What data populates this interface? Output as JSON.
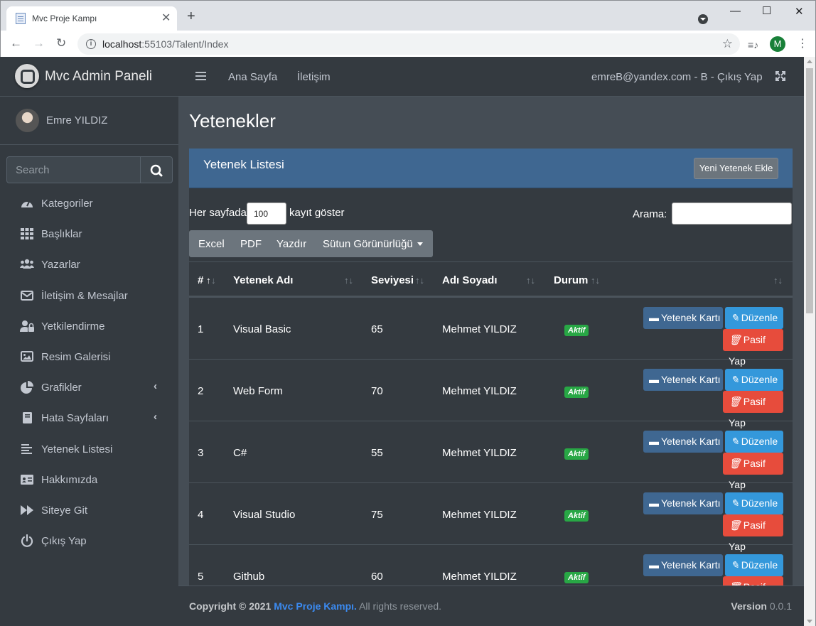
{
  "browser": {
    "tab_title": "Mvc Proje Kampı",
    "url_host": "localhost",
    "url_rest": ":55103/Talent/Index",
    "profile_initial": "M"
  },
  "sidebar": {
    "brand": "Mvc Admin Paneli",
    "user": "Emre YILDIZ",
    "search_placeholder": "Search",
    "items": [
      {
        "label": "Kategoriler",
        "icon": "tachometer-icon"
      },
      {
        "label": "Başlıklar",
        "icon": "grid-icon"
      },
      {
        "label": "Yazarlar",
        "icon": "users-icon"
      },
      {
        "label": "İletişim & Mesajlar",
        "icon": "envelope-icon"
      },
      {
        "label": "Yetkilendirme",
        "icon": "user-lock-icon"
      },
      {
        "label": "Resim Galerisi",
        "icon": "image-icon"
      },
      {
        "label": "Grafikler",
        "icon": "pie-chart-icon",
        "chevron": true
      },
      {
        "label": "Hata Sayfaları",
        "icon": "book-icon",
        "chevron": true
      },
      {
        "label": "Yetenek Listesi",
        "icon": "align-left-icon"
      },
      {
        "label": "Hakkımızda",
        "icon": "id-card-icon"
      },
      {
        "label": "Siteye Git",
        "icon": "forward-icon"
      },
      {
        "label": "Çıkış Yap",
        "icon": "power-icon"
      }
    ]
  },
  "topbar": {
    "home": "Ana Sayfa",
    "contact": "İletişim",
    "account": "emreB@yandex.com - B - Çıkış Yap"
  },
  "page": {
    "title": "Yetenekler",
    "card_title": "Yetenek Listesi",
    "new_button": "Yeni Yetenek Ekle",
    "per_page_label": "Her sayfada",
    "per_page_value": "100",
    "per_page_suffix": "kayıt göster",
    "search_label": "Arama:",
    "export_buttons": [
      "Excel",
      "PDF",
      "Yazdır",
      "Sütun Görünürlüğü"
    ],
    "columns": [
      "#",
      "Yetenek Adı",
      "Seviyesi",
      "Adı Soyadı",
      "Durum"
    ],
    "btn_card": "Yetenek Kartı",
    "btn_edit": "Düzenle",
    "btn_passive": "Pasif Yap",
    "rows": [
      {
        "id": "1",
        "name": "Visual Basic",
        "level": "65",
        "person": "Mehmet YILDIZ",
        "status": "Aktif"
      },
      {
        "id": "2",
        "name": "Web Form",
        "level": "70",
        "person": "Mehmet YILDIZ",
        "status": "Aktif"
      },
      {
        "id": "3",
        "name": "C#",
        "level": "55",
        "person": "Mehmet YILDIZ",
        "status": "Aktif"
      },
      {
        "id": "4",
        "name": "Visual Studio",
        "level": "75",
        "person": "Mehmet YILDIZ",
        "status": "Aktif"
      },
      {
        "id": "5",
        "name": "Github",
        "level": "60",
        "person": "Mehmet YILDIZ",
        "status": "Aktif"
      }
    ]
  },
  "footer": {
    "copy_prefix": "Copyright © 2021",
    "copy_link": "Mvc Proje Kampı.",
    "copy_suffix": "All rights reserved.",
    "version_label": "Version",
    "version_value": "0.0.1"
  },
  "colors": {
    "sidebar": "#343a40",
    "content": "#454d55",
    "card_header": "#3f6791",
    "badge_active": "#28a745",
    "edit_button": "#3498db",
    "passive_button": "#e74c3c"
  }
}
